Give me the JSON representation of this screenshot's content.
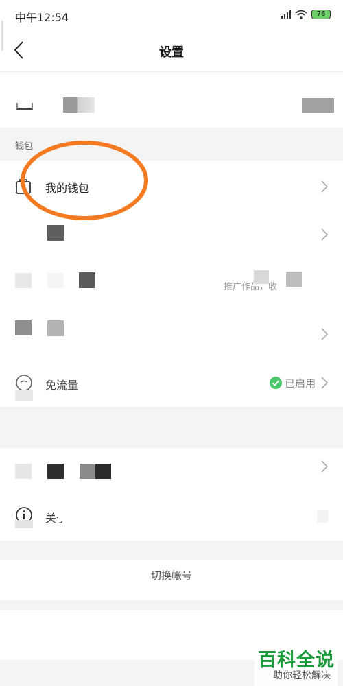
{
  "status_bar": {
    "time": "中午12:54",
    "battery": "76"
  },
  "header": {
    "title": "设置"
  },
  "sections": {
    "wallet_label": "钱包"
  },
  "rows": {
    "my_wallet": "我的钱包",
    "promote": "推广作品，收",
    "free_data": "免流量",
    "free_data_status": "已启用",
    "about": "关于",
    "switch_account": "切换帐号"
  },
  "icons": {
    "back": "chevron-left-icon",
    "wallet": "wallet-icon",
    "info": "info-icon",
    "check": "check-circle-icon",
    "chevron": "chevron-right-icon"
  },
  "watermark": {
    "main": "百科全说",
    "sub": "助你轻松解决"
  },
  "colors": {
    "accent_orange": "#f37a20",
    "status_green": "#4cc66a",
    "watermark_green": "#1a9c3c"
  }
}
